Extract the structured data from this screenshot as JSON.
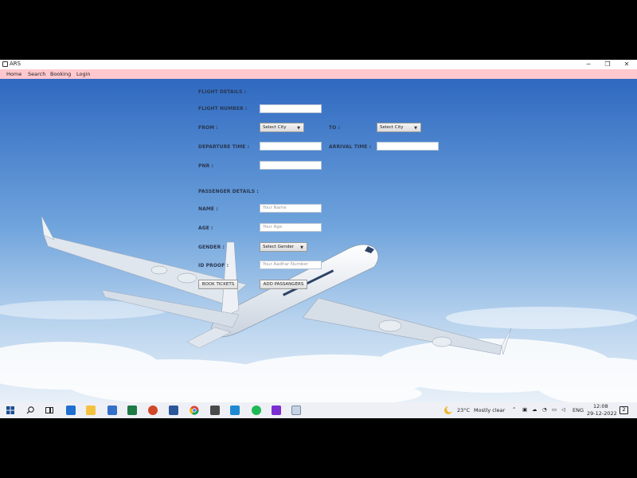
{
  "window": {
    "title": "ARS",
    "minimize_glyph": "─",
    "maximize_glyph": "❐",
    "close_glyph": "✕"
  },
  "menu": {
    "items": [
      "Home",
      "Search",
      "Booking",
      "Login"
    ]
  },
  "form": {
    "flight_section": "FLIGHT DETAILS :",
    "flight_number_label": "FLIGHT NUMBER :",
    "from_label": "FROM :",
    "from_value": "Select City",
    "to_label": "TO :",
    "to_value": "Select City",
    "departure_label": "DEPARTURE TIME :",
    "arrival_label": "ARRIVAL TIME :",
    "pnr_label": "PNR :",
    "passenger_section": "PASSENGER DETAILS :",
    "name_label": "NAME :",
    "name_placeholder": "Your Name",
    "age_label": "AGE :",
    "age_placeholder": "Your Age",
    "gender_label": "GENDER :",
    "gender_value": "Select Gender",
    "id_label": "ID PROOF :",
    "id_placeholder": "Your Aadhar Number",
    "book_button": "BOOK TICKETS",
    "add_button": "ADD PASSANGERS"
  },
  "taskbar": {
    "icons": [
      "windows-start-icon",
      "search-icon",
      "task-view-icon",
      "mail-icon",
      "file-explorer-icon",
      "teams-icon",
      "excel-icon",
      "powerpoint-icon",
      "word-icon",
      "chrome-icon",
      "sublime-icon",
      "vscode-icon",
      "spotify-icon",
      "intellij-icon",
      "java-app-icon"
    ],
    "weather_temp": "23°C",
    "weather_text": "Mostly clear",
    "language": "ENG",
    "time": "12:08",
    "date": "29-12-2022",
    "notification_count": "2"
  },
  "colors": {
    "menubar": "#ffc8cf",
    "sky_top": "#3a72c4",
    "sky_bottom": "#dfeaf5"
  }
}
